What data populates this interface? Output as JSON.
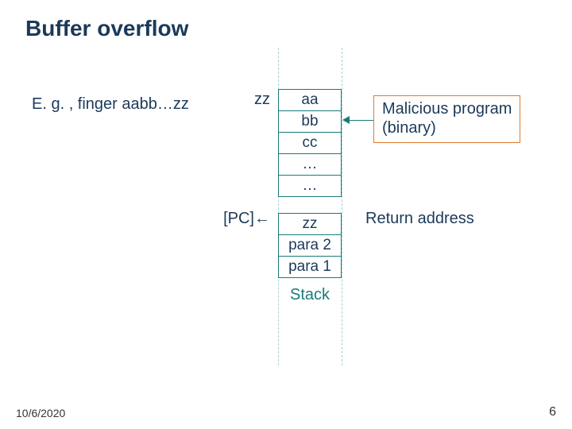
{
  "title": "Buffer overflow",
  "subtitle": "E. g. , finger aabb…zz",
  "left_labels": {
    "zz": "zz",
    "pc": "[PC]"
  },
  "stack_cells": {
    "c0": "aa",
    "c1": "bb",
    "c2": "cc",
    "c3": "…",
    "c4": "…",
    "c5": "zz",
    "c6": "para 2",
    "c7": "para 1"
  },
  "stack_label": "Stack",
  "right_labels": {
    "malicious_line1": "Malicious program",
    "malicious_line2": "(binary)",
    "return_addr": "Return address"
  },
  "arrow_glyph": "←",
  "footer": {
    "date": "10/6/2020",
    "page": "6"
  }
}
